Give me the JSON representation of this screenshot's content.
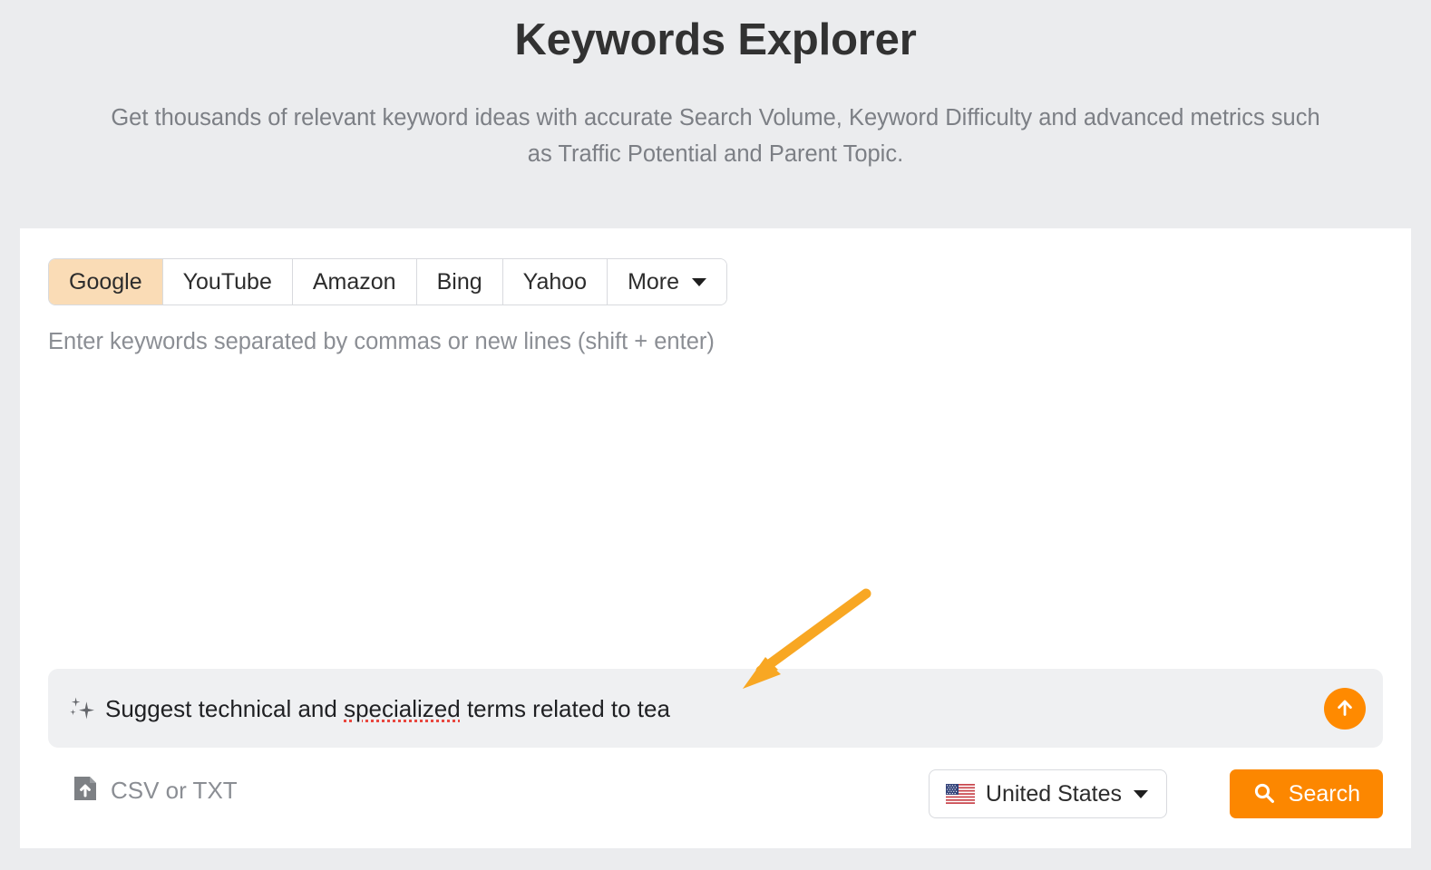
{
  "header": {
    "title": "Keywords Explorer",
    "subtitle": "Get thousands of relevant keyword ideas with accurate Search Volume, Keyword Difficulty and advanced metrics such as Traffic Potential and Parent Topic."
  },
  "tabs": [
    {
      "label": "Google",
      "active": true
    },
    {
      "label": "YouTube",
      "active": false
    },
    {
      "label": "Amazon",
      "active": false
    },
    {
      "label": "Bing",
      "active": false
    },
    {
      "label": "Yahoo",
      "active": false
    },
    {
      "label": "More",
      "active": false,
      "icon": "chevron-down-icon"
    }
  ],
  "keywords_input": {
    "value": "",
    "placeholder": "Enter keywords separated by commas or new lines (shift + enter)"
  },
  "suggestion": {
    "icon": "sparkle-icon",
    "text_before": "Suggest technical and ",
    "misspelled_word": "specialized",
    "text_after": " terms related to tea",
    "full_text": "Suggest technical and specialized terms related to tea",
    "submit_icon": "arrow-up-circle-icon"
  },
  "upload": {
    "icon": "file-upload-icon",
    "label": "CSV or TXT"
  },
  "country_selector": {
    "icon": "us-flag-icon",
    "value": "United States",
    "caret": "chevron-down-icon"
  },
  "search_button": {
    "icon": "search-icon",
    "label": "Search"
  },
  "annotation": {
    "type": "arrow",
    "color": "#f8a723",
    "points_to": "suggestion-bar"
  },
  "colors": {
    "page_background": "#ebecee",
    "card_background": "#ffffff",
    "accent_orange": "#fc8700",
    "active_tab": "#fadcb6",
    "suggestion_background": "#eff0f2",
    "muted_text": "#8b8e94",
    "annotation_orange": "#f8a723",
    "spellcheck_red": "#e8473f"
  }
}
